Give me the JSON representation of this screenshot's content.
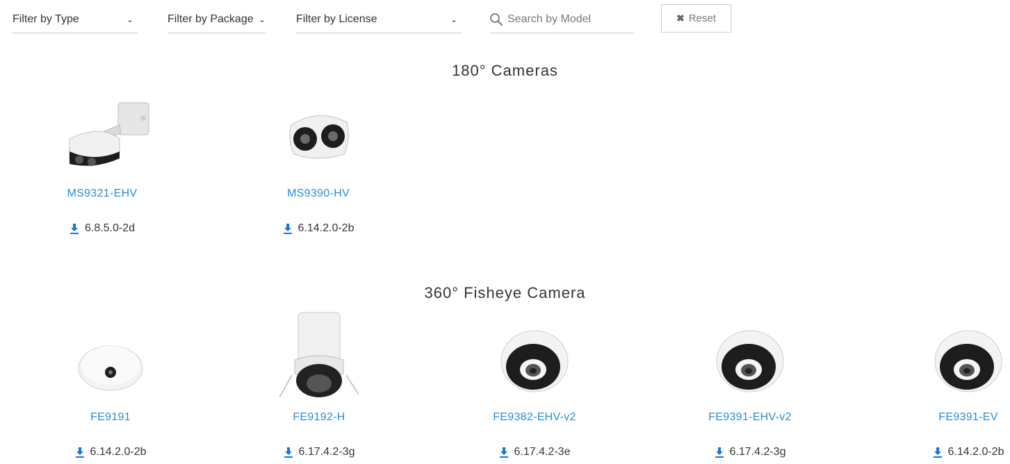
{
  "filters": {
    "type_label": "Filter by Type",
    "package_label": "Filter by Package",
    "license_label": "Filter by License"
  },
  "search": {
    "placeholder": "Search by Model"
  },
  "reset_label": "Reset",
  "sections": [
    {
      "title": "180° Cameras",
      "items": [
        {
          "model": "MS9321-EHV",
          "firmware": "6.8.5.0-2d"
        },
        {
          "model": "MS9390-HV",
          "firmware": "6.14.2.0-2b"
        }
      ]
    },
    {
      "title": "360° Fisheye Camera",
      "items": [
        {
          "model": "FE9191",
          "firmware": "6.14.2.0-2b"
        },
        {
          "model": "FE9192-H",
          "firmware": "6.17.4.2-3g"
        },
        {
          "model": "FE9382-EHV-v2",
          "firmware": "6.17.4.2-3e"
        },
        {
          "model": "FE9391-EHV-v2",
          "firmware": "6.17.4.2-3g"
        },
        {
          "model": "FE9391-EV",
          "firmware": "6.14.2.0-2b"
        }
      ]
    }
  ],
  "colors": {
    "link": "#2a8bd6",
    "download_icon": "#1a73d9"
  },
  "icons": {
    "download": "download-icon",
    "search": "search-icon",
    "reset": "times-icon",
    "dropdown": "chevron-down-icon"
  }
}
